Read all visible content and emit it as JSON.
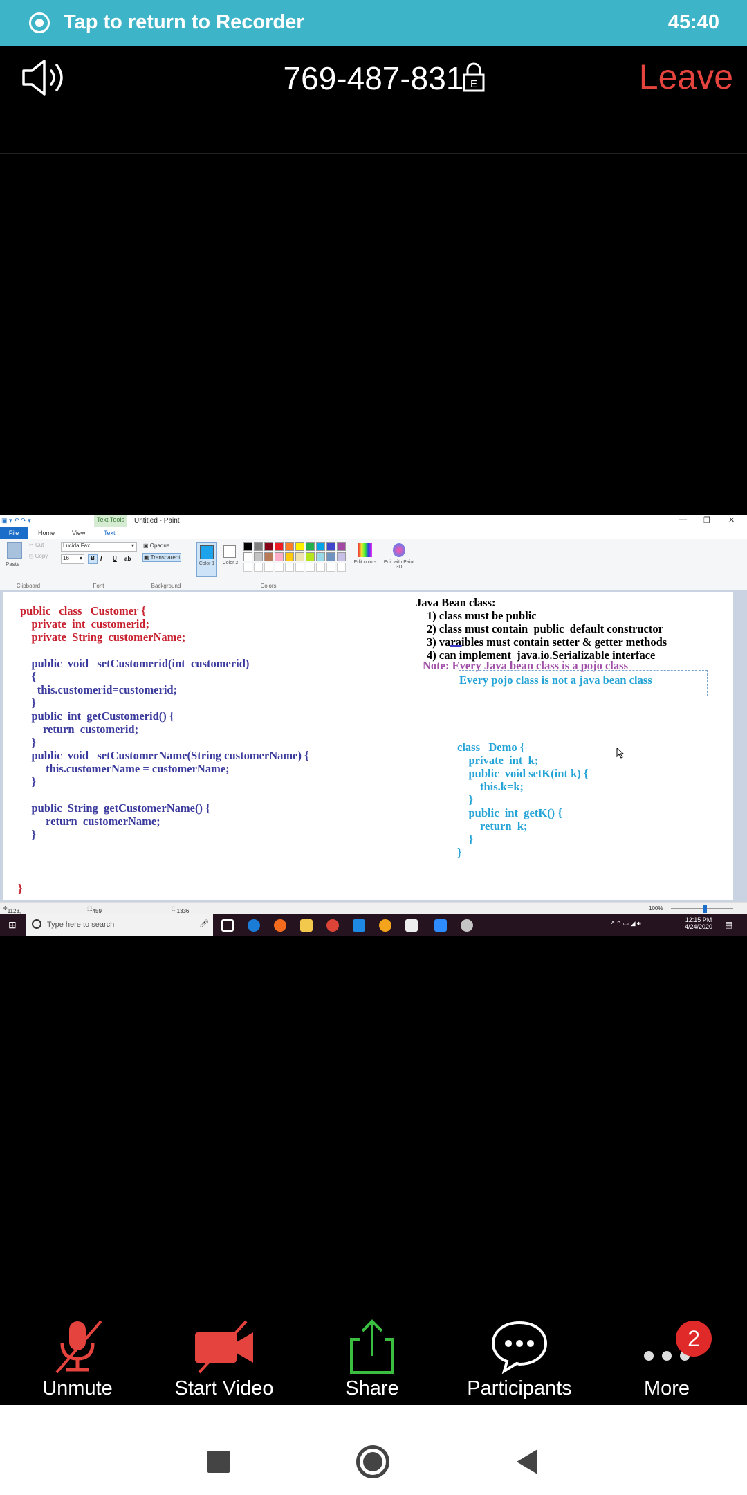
{
  "recorder_bar": {
    "label": "Tap to return to Recorder",
    "time": "45:40"
  },
  "meeting": {
    "id": "769-487-831",
    "leave_label": "Leave"
  },
  "paint": {
    "title": "Untitled - Paint",
    "text_tools": "Text Tools",
    "tabs": [
      "File",
      "Home",
      "View",
      "Text"
    ],
    "ribbon": {
      "clipboard": {
        "paste": "Paste",
        "cut": "Cut",
        "copy": "Copy",
        "label": "Clipboard"
      },
      "font": {
        "family": "Lucida Fax",
        "size": "16",
        "label": "Font"
      },
      "background": {
        "opaque": "Opaque",
        "transparent": "Transparent",
        "label": "Background"
      },
      "colors": {
        "color1": "Color 1",
        "color2": "Color 2",
        "edit": "Edit colors",
        "paint3d": "Edit with Paint 3D",
        "label": "Colors"
      }
    },
    "code_left": [
      {
        "text": "public   class   Customer {",
        "color": "#c8202e"
      },
      {
        "text": "    private  int  customerid;",
        "color": "#c8202e"
      },
      {
        "text": "    private  String  customerName;",
        "color": "#c8202e"
      },
      {
        "text": "",
        "color": "#3b3b9e"
      },
      {
        "text": "    public  void   setCustomerid(int  customerid)",
        "color": "#3b3b9e"
      },
      {
        "text": "    {",
        "color": "#3b3b9e"
      },
      {
        "text": "      this.customerid=customerid;",
        "color": "#3b3b9e"
      },
      {
        "text": "    }",
        "color": "#3b3b9e"
      },
      {
        "text": "    public  int  getCustomerid() {",
        "color": "#3b3b9e"
      },
      {
        "text": "        return  customerid;",
        "color": "#3b3b9e"
      },
      {
        "text": "    }",
        "color": "#3b3b9e"
      },
      {
        "text": "    public  void   setCustomerName(String customerName) {",
        "color": "#3b3b9e"
      },
      {
        "text": "         this.customerName = customerName;",
        "color": "#3b3b9e"
      },
      {
        "text": "    }",
        "color": "#3b3b9e"
      },
      {
        "text": "",
        "color": "#3b3b9e"
      },
      {
        "text": "    public  String  getCustomerName() {",
        "color": "#3b3b9e"
      },
      {
        "text": "         return  customerName;",
        "color": "#3b3b9e"
      },
      {
        "text": "    }",
        "color": "#3b3b9e"
      }
    ],
    "closing_brace": "}",
    "bean_title": "Java Bean class:",
    "bean_rules": [
      "1) class must be public",
      "2) class must contain  public  default constructor",
      "3) varaibles must contain setter & getter methods",
      "4) can implement  java.io.Serializable interface"
    ],
    "note_line1": "Note: Every Java bean class is a pojo class",
    "note_line2": "Every pojo class is not a java bean class",
    "demo_code": [
      "class   Demo {",
      "    private  int  k;",
      "    public  void setK(int k) {",
      "        this.k=k;",
      "    }",
      "    public  int  getK() {",
      "        return  k;",
      "    }",
      "}"
    ],
    "status": {
      "cursor": "1123, 390px",
      "selection": "459 × 66px",
      "canvas": "1336 × 570px",
      "zoom": "100%"
    },
    "taskbar": {
      "search_placeholder": "Type here to search",
      "time": "12:15 PM",
      "date": "4/24/2020"
    }
  },
  "toolbar": {
    "unmute": "Unmute",
    "start_video": "Start Video",
    "share": "Share",
    "participants": "Participants",
    "more": "More",
    "badge_count": "2"
  }
}
